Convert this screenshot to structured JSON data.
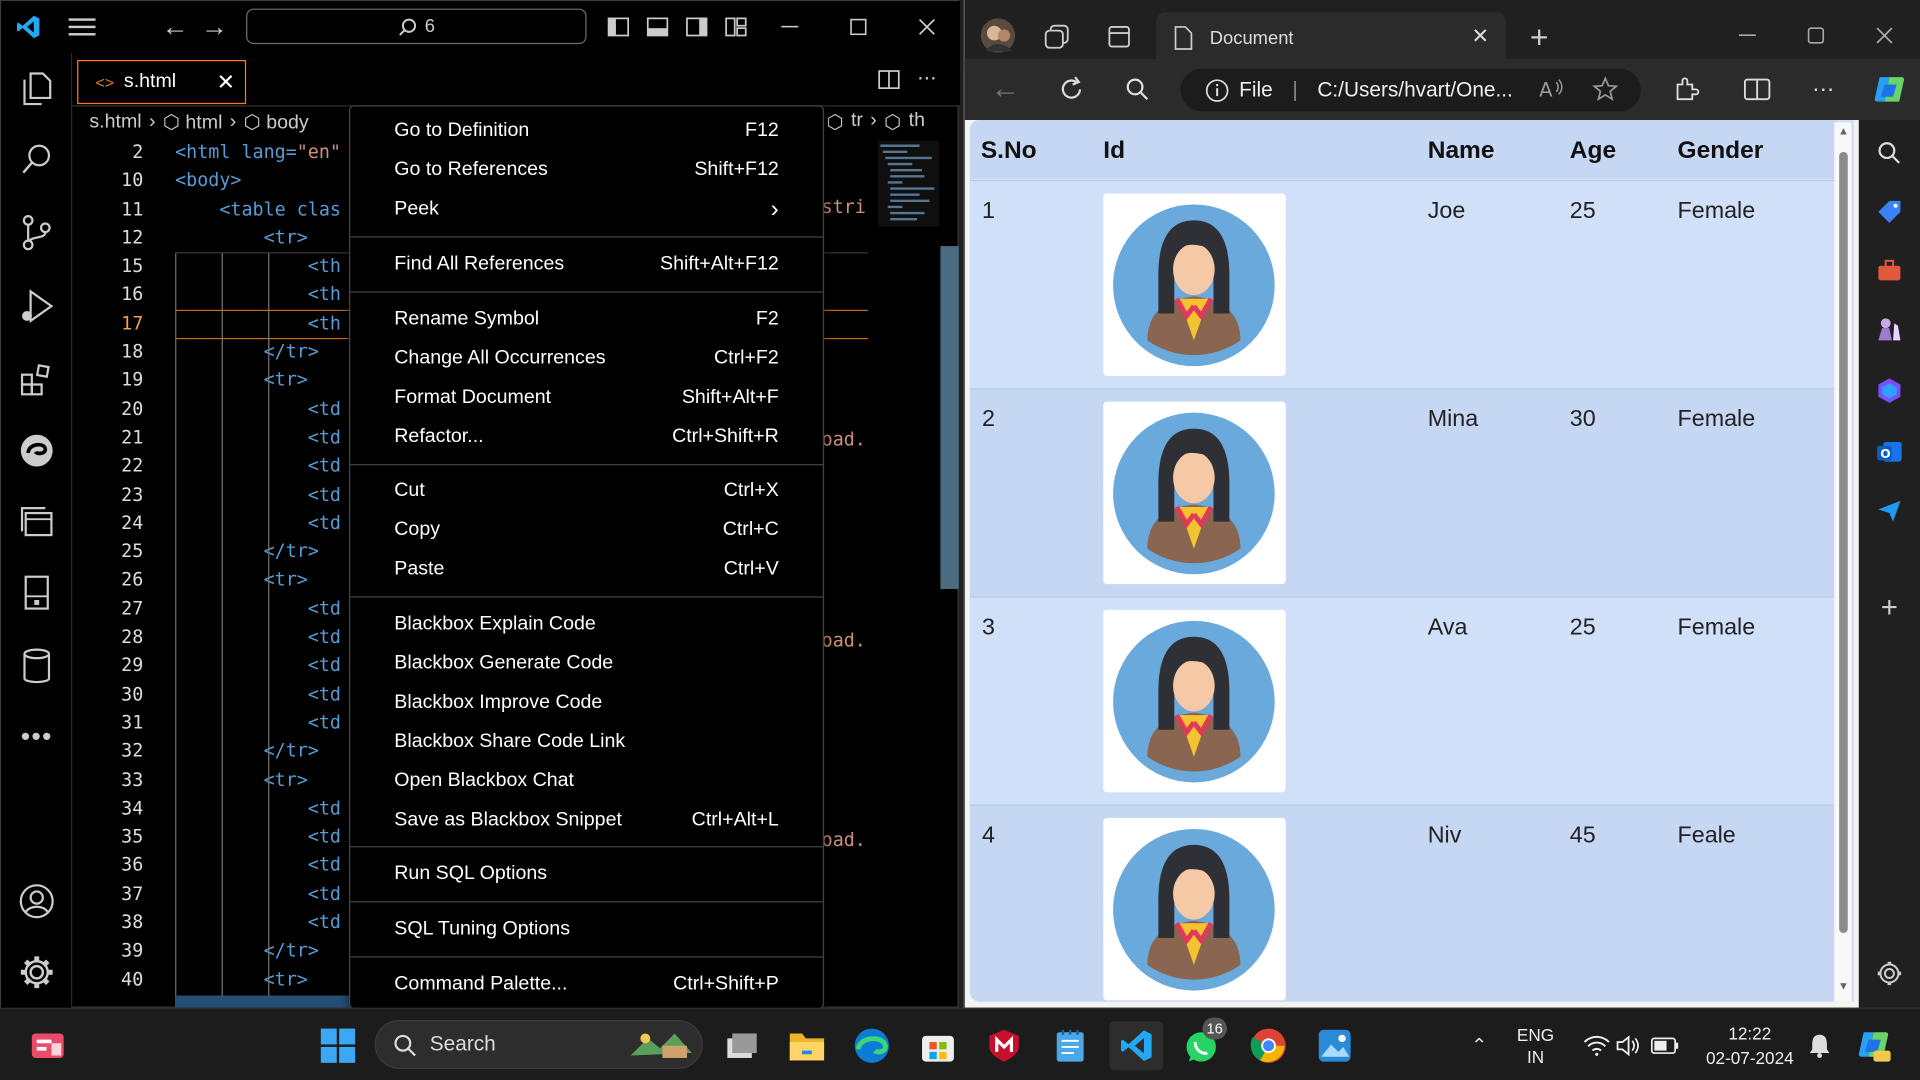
{
  "vscode": {
    "search_text": "6",
    "tab_label": "s.html",
    "breadcrumb": [
      "s.html",
      "html",
      "body",
      "tr",
      "th"
    ],
    "line_numbers": [
      "2",
      "10",
      "11",
      "12",
      "15",
      "16",
      "17",
      "18",
      "19",
      "20",
      "21",
      "22",
      "23",
      "24",
      "25",
      "26",
      "27",
      "28",
      "29",
      "30",
      "31",
      "32",
      "33",
      "34",
      "35",
      "36",
      "37",
      "38",
      "39",
      "40"
    ],
    "code": {
      "l2_tag": "<html lang=",
      "l2_str": "\"en\"",
      "l10": "<body>",
      "l11_tag": "<table clas",
      "tr_open": "<tr>",
      "tr_close": "</tr>",
      "th": "<th",
      "td": "<td",
      "right_stri": "stri",
      "right_oad": "oad."
    }
  },
  "context_menu": {
    "items": [
      {
        "label": "Go to Definition",
        "key": "F12"
      },
      {
        "label": "Go to References",
        "key": "Shift+F12"
      },
      {
        "label": "Peek",
        "key": ""
      },
      {
        "label": "Find All References",
        "key": "Shift+Alt+F12"
      },
      {
        "label": "Rename Symbol",
        "key": "F2"
      },
      {
        "label": "Change All Occurrences",
        "key": "Ctrl+F2"
      },
      {
        "label": "Format Document",
        "key": "Shift+Alt+F"
      },
      {
        "label": "Refactor...",
        "key": "Ctrl+Shift+R"
      },
      {
        "label": "Cut",
        "key": "Ctrl+X"
      },
      {
        "label": "Copy",
        "key": "Ctrl+C"
      },
      {
        "label": "Paste",
        "key": "Ctrl+V"
      },
      {
        "label": "Blackbox Explain Code",
        "key": ""
      },
      {
        "label": "Blackbox Generate Code",
        "key": ""
      },
      {
        "label": "Blackbox Improve Code",
        "key": ""
      },
      {
        "label": "Blackbox Share Code Link",
        "key": ""
      },
      {
        "label": "Open Blackbox Chat",
        "key": ""
      },
      {
        "label": "Save as Blackbox Snippet",
        "key": "Ctrl+Alt+L"
      },
      {
        "label": "Run SQL Options",
        "key": ""
      },
      {
        "label": "SQL Tuning Options",
        "key": ""
      },
      {
        "label": "Command Palette...",
        "key": "Ctrl+Shift+P"
      }
    ]
  },
  "browser": {
    "tab_title": "Document",
    "address_scheme": "File",
    "address_path": "C:/Users/hvart/One...",
    "table": {
      "headers": [
        "S.No",
        "Id",
        "Name",
        "Age",
        "Gender"
      ],
      "rows": [
        {
          "sno": "1",
          "name": "Joe",
          "age": "25",
          "gender": "Female"
        },
        {
          "sno": "2",
          "name": "Mina",
          "age": "30",
          "gender": "Female"
        },
        {
          "sno": "3",
          "name": "Ava",
          "age": "25",
          "gender": "Female"
        },
        {
          "sno": "4",
          "name": "Niv",
          "age": "45",
          "gender": "Feale"
        }
      ]
    }
  },
  "taskbar": {
    "search_label": "Search",
    "whatsapp_badge": "16",
    "lang_top": "ENG",
    "lang_bottom": "IN",
    "time": "12:22",
    "date": "02-07-2024"
  }
}
